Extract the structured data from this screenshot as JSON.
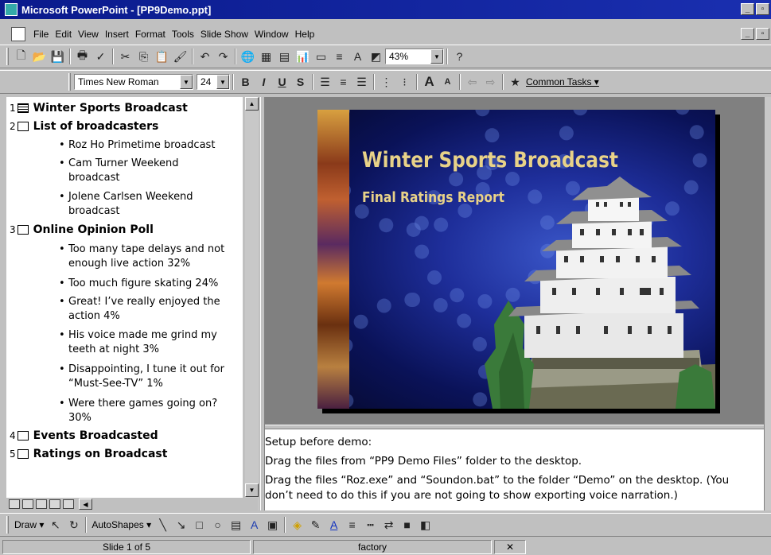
{
  "window": {
    "title": "Microsoft PowerPoint - [PP9Demo.ppt]",
    "min": "_",
    "max": "▫",
    "close": "×"
  },
  "menus": [
    "File",
    "Edit",
    "View",
    "Insert",
    "Format",
    "Tools",
    "Slide Show",
    "Window",
    "Help"
  ],
  "toolbar": {
    "zoom": "43%",
    "font_name": "Times New Roman",
    "font_size": "24",
    "bold": "B",
    "italic": "I",
    "underline": "U",
    "shadow": "S",
    "common_tasks": "Common Tasks ▾"
  },
  "outline": {
    "slides": [
      {
        "num": "1",
        "title": "Winter Sports Broadcast",
        "bullets": []
      },
      {
        "num": "2",
        "title": "List of broadcasters",
        "bullets": [
          "Roz Ho    Primetime broadcast",
          "Cam Turner     Weekend",
          "broadcast",
          "Jolene Carlsen    Weekend",
          "broadcast"
        ]
      },
      {
        "num": "3",
        "title": "Online Opinion Poll",
        "bullets": [
          "Too many tape delays and not",
          "enough live action 32%",
          "Too much figure skating 24%",
          "Great!  I’ve really enjoyed the",
          "action 4%",
          "His voice made me grind my",
          "teeth at night 3%",
          "Disappointing, I tune it out for",
          "“Must-See-TV” 1%",
          "Were there games going on?",
          "30%"
        ]
      },
      {
        "num": "4",
        "title": "Events Broadcasted",
        "bullets": []
      },
      {
        "num": "5",
        "title": "Ratings on Broadcast",
        "bullets": []
      }
    ]
  },
  "slide": {
    "title": "Winter Sports Broadcast",
    "subtitle": "Final Ratings Report"
  },
  "notes": [
    "Setup before demo:",
    "Drag the files from “PP9 Demo Files” folder to the desktop.",
    "Drag the files “Roz.exe” and “Soundon.bat” to the folder “Demo” on the desktop. (You",
    "don’t need to do this if you are not going to show exporting voice narration.)"
  ],
  "drawing": {
    "draw": "Draw ▾",
    "autoshapes": "AutoShapes ▾"
  },
  "status": {
    "slide": "Slide 1 of 5",
    "design": "factory"
  }
}
